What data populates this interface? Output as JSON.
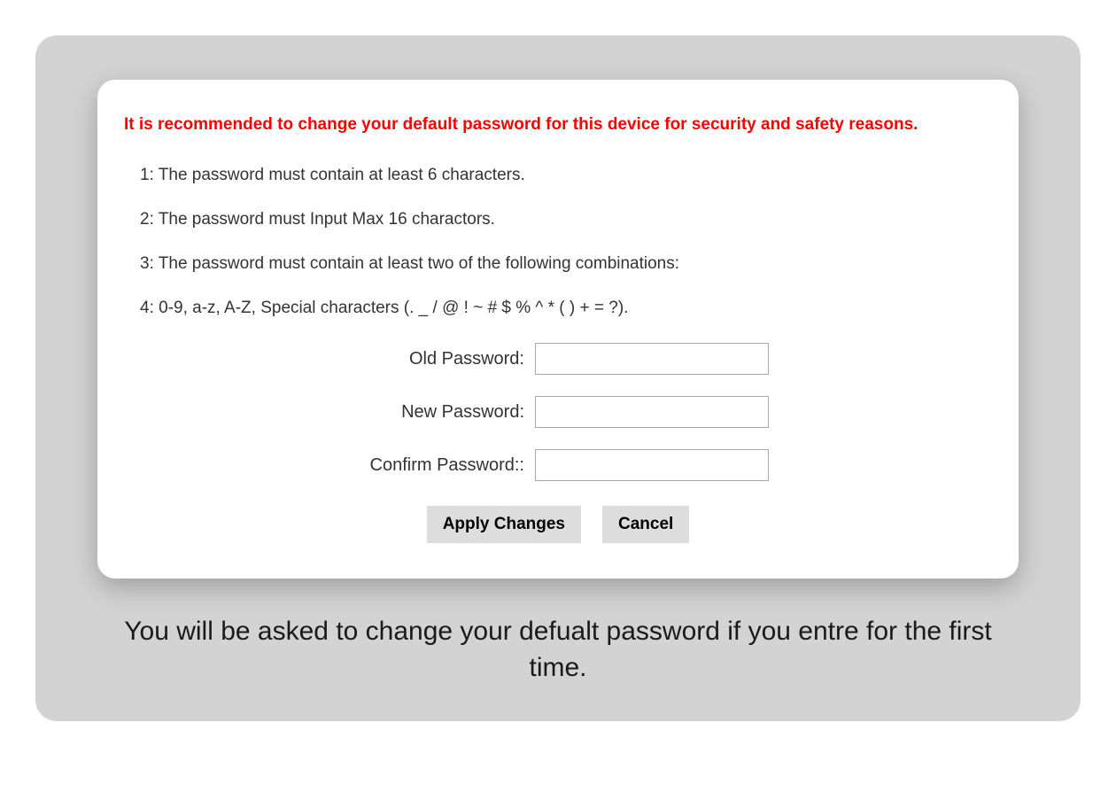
{
  "dialog": {
    "warning": "It is recommended to change your default password for this device for security and safety reasons.",
    "rules": {
      "rule1": "1: The password must contain at least 6 characters.",
      "rule2": "2: The password must Input Max 16 charactors.",
      "rule3": "3: The password must contain at least two of the following combinations:",
      "rule4": "4: 0-9, a-z, A-Z, Special characters (. _ / @ ! ~ # $ % ^ * ( ) + = ?)."
    },
    "form": {
      "old_password_label": "Old Password:",
      "old_password_value": "",
      "new_password_label": "New Password:",
      "new_password_value": "",
      "confirm_password_label": "Confirm Password::",
      "confirm_password_value": ""
    },
    "buttons": {
      "apply_label": "Apply Changes",
      "cancel_label": "Cancel"
    }
  },
  "caption": "You will be asked to change your defualt password if you entre for the first time."
}
